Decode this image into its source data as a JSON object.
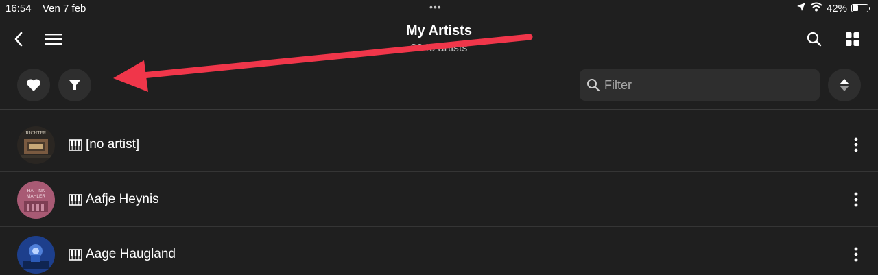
{
  "status_bar": {
    "time": "16:54",
    "date": "Ven 7 feb",
    "dots": "•••",
    "battery_text": "42%",
    "battery_level": 0.42
  },
  "header": {
    "title": "My Artists",
    "subtitle": "3046 artists"
  },
  "toolbar": {
    "filter_placeholder": "Filter"
  },
  "artists": [
    {
      "name": "[no artist]",
      "icon": "piano-icon"
    },
    {
      "name": "Aafje Heynis",
      "icon": "piano-icon"
    },
    {
      "name": "Aage Haugland",
      "icon": "piano-icon"
    }
  ],
  "avatar_labels": {
    "first": "RICHTER",
    "second_line1": "HAITINK",
    "second_line2": "MAHLER"
  },
  "colors": {
    "background": "#1f1f1f",
    "annotation_arrow": "#f0364a"
  }
}
